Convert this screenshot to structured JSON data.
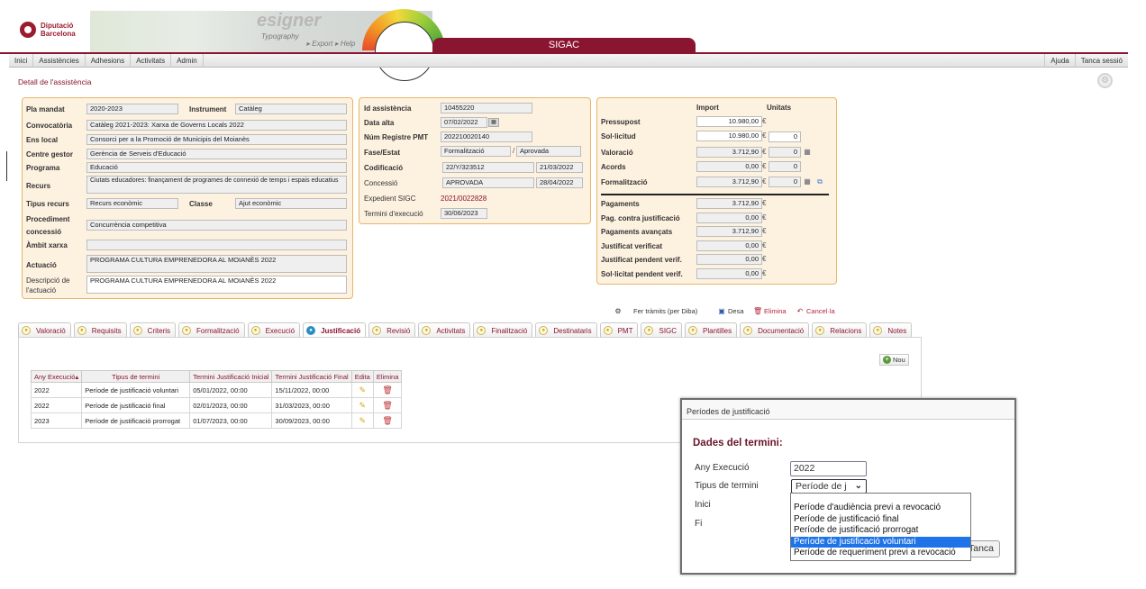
{
  "header": {
    "logo_line1": "Diputació",
    "logo_line2": "Barcelona",
    "banner_word": "esigner",
    "banner_sub1": "Typography",
    "banner_sub2": "▸ Export   ▸ Help",
    "app_title": "SIGAC"
  },
  "menu": {
    "items": [
      "Inici",
      "Assistències",
      "Adhesions",
      "Activitats",
      "Admin"
    ],
    "right": [
      "Ajuda",
      "Tanca sessió"
    ]
  },
  "page_title": "Detall de l'assistència",
  "left_panel": {
    "pla_mandat_label": "Pla mandat",
    "pla_mandat": "2020-2023",
    "instrument_label": "Instrument",
    "instrument": "Catàleg",
    "convocatoria_label": "Convocatòria",
    "convocatoria": "Catàleg 2021-2023: Xarxa de Governs Locals 2022",
    "ens_local_label": "Ens local",
    "ens_local": "Consorci per a la Promoció de Municipis del Moianès",
    "centre_gestor_label": "Centre gestor",
    "centre_gestor": "Gerència de Serveis d'Educació",
    "programa_label": "Programa",
    "programa": "Educació",
    "recurs_label": "Recurs",
    "recurs": "Ciutats educadores: finançament de programes de connexió de temps i espais educatius",
    "tipus_recurs_label": "Tipus recurs",
    "tipus_recurs": "Recurs econòmic",
    "classe_label": "Classe",
    "classe": "Ajut econòmic",
    "procediment_label1": "Procediment",
    "procediment_label2": "concessió",
    "procediment": "Concurrència competitiva",
    "ambit_label": "Àmbit xarxa",
    "ambit": "",
    "actuacio_label": "Actuació",
    "actuacio": "PROGRAMA CULTURA EMPRENEDORA AL MOIANÈS 2022",
    "descripcio_label1": "Descripció de",
    "descripcio_label2": "l'actuació",
    "descripcio": "PROGRAMA CULTURA EMPRENEDORA AL MOIANÈS 2022"
  },
  "mid_panel": {
    "id_label": "Id assistència",
    "id": "10455220",
    "data_alta_label": "Data alta",
    "data_alta": "07/02/2022",
    "pmt_label": "Núm Registre PMT",
    "pmt": "202210020140",
    "fase_label": "Fase/Estat",
    "fase": "Formalització",
    "estat": "Aprovada",
    "codificacio_label": "Codificació",
    "codificacio": "22/Y/323512",
    "codificacio_date": "21/03/2022",
    "concessio_label": "Concessió",
    "concessio": "APROVADA",
    "concessio_date": "28/04/2022",
    "expedient_label": "Expedient SIGC",
    "expedient": "2021/0022828",
    "termini_label": "Termini d'execució",
    "termini": "30/06/2023"
  },
  "right_panel": {
    "col_import": "Import",
    "col_unitats": "Unitats",
    "rows": [
      {
        "label": "Pressupost",
        "import": "10.980,00",
        "unitats": null
      },
      {
        "label": "Sol·licitud",
        "import": "10.980,00",
        "unitats": "0"
      },
      {
        "label": "Valoració",
        "import": "3.712,90",
        "unitats": "0"
      },
      {
        "label": "Acords",
        "import": "0,00",
        "unitats": "0"
      },
      {
        "label": "Formalització",
        "import": "3.712,90",
        "unitats": "0"
      }
    ],
    "rows2": [
      {
        "label": "Pagaments",
        "import": "3.712,90"
      },
      {
        "label": "Pag. contra justificació",
        "import": "0,00"
      },
      {
        "label": "Pagaments avançats",
        "import": "3.712,90"
      },
      {
        "label": "Justificat verificat",
        "import": "0,00"
      },
      {
        "label": "Justificat pendent verif.",
        "import": "0,00"
      },
      {
        "label": "Sol·licitat pendent verif.",
        "import": "0,00"
      }
    ],
    "currency": "€"
  },
  "actions": {
    "tramits": "Fer tràmits (per Diba)",
    "desa": "Desa",
    "elimina": "Elimina",
    "cancel": "Cancel·la"
  },
  "tabs": [
    "Valoració",
    "Requisits",
    "Criteris",
    "Formalització",
    "Execució",
    "Justificació",
    "Revisió",
    "Activitats",
    "Finalització",
    "Destinataris",
    "PMT",
    "SIGC",
    "Plantilles",
    "Documentació",
    "Relacions",
    "Notes"
  ],
  "active_tab": "Justificació",
  "justificacio": {
    "nou_label": "Nou",
    "columns": [
      "Any Execució",
      "Tipus de termini",
      "Termini Justificació Inicial",
      "Termini Justificació Final",
      "Edita",
      "Elimina"
    ],
    "sort_arrow": "▴",
    "rows": [
      [
        "2022",
        "Període de justificació voluntari",
        "05/01/2022, 00:00",
        "15/11/2022, 00:00"
      ],
      [
        "2022",
        "Període de justificació final",
        "02/01/2023, 00:00",
        "31/03/2023, 00:00"
      ],
      [
        "2023",
        "Període de justificació prorrogat",
        "01/07/2023, 00:00",
        "30/09/2023, 00:00"
      ]
    ]
  },
  "dialog": {
    "title": "Períodes de justificació",
    "heading": "Dades del termini:",
    "any_label": "Any Execució",
    "any_value": "2022",
    "tipus_label": "Tipus de termini",
    "tipus_value": "Període de j",
    "inici_label": "Inici",
    "fi_label": "Fi",
    "tanca": "Tanca",
    "options": [
      "Període d'audiència previ a revocació",
      "Període de justificació final",
      "Període de justificació prorrogat",
      "Període de justificació voluntari",
      "Període de requeriment previ a revocació"
    ],
    "selected_option": "Període de justificació voluntari"
  }
}
